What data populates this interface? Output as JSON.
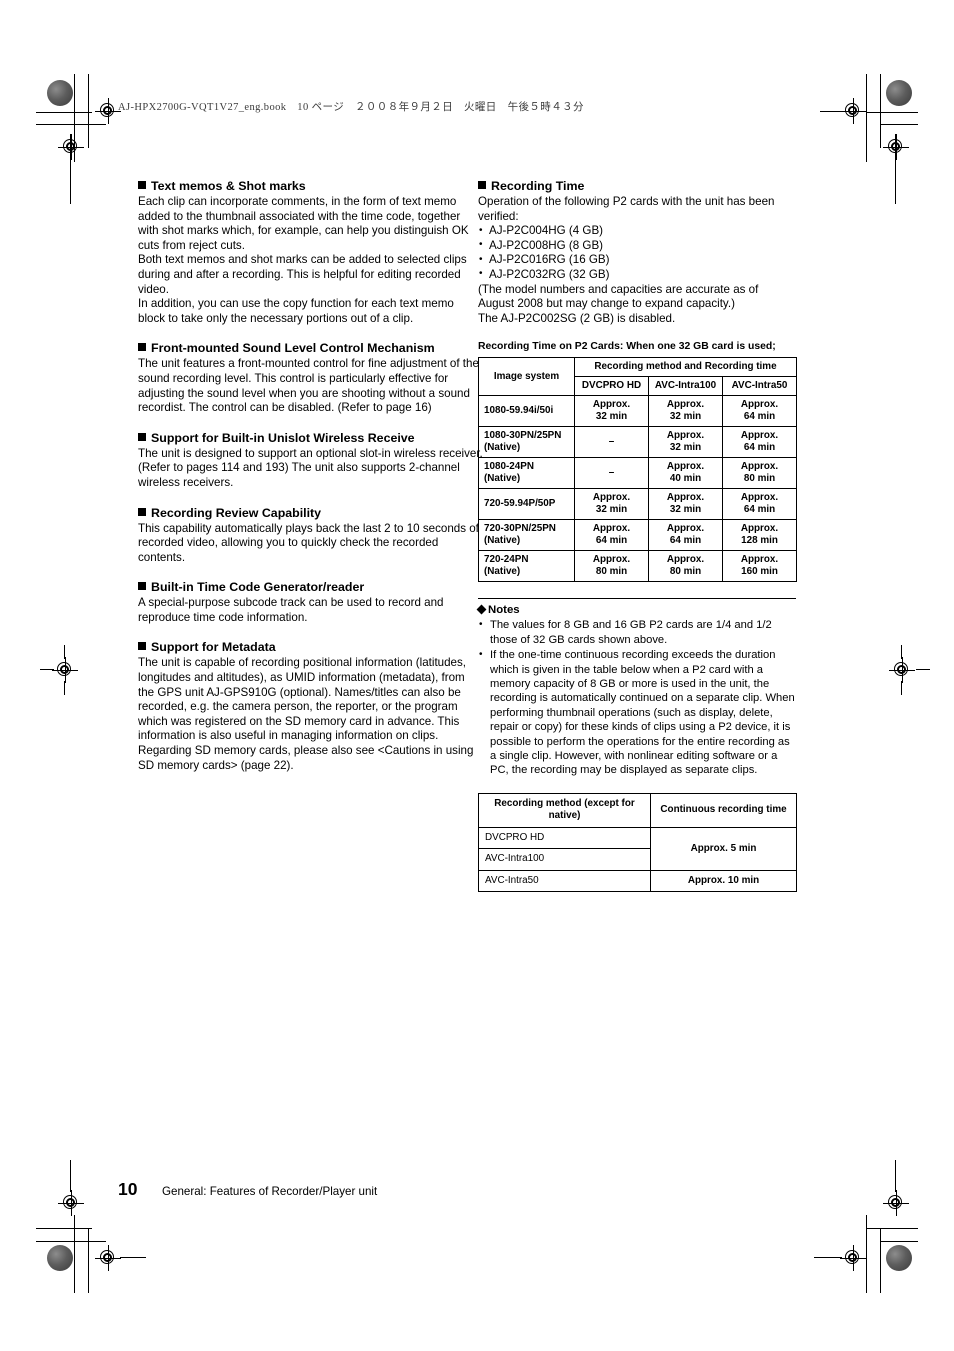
{
  "header": {
    "book_line_ascii": "AJ-HPX2700G-VQT1V27_eng.book",
    "book_line_full": "AJ-HPX2700G-VQT1V27_eng.book　10 ページ　２００８年９月２日　火曜日　午後５時４３分"
  },
  "left_column": {
    "sections": [
      {
        "title": "Text memos & Shot marks",
        "paragraphs": [
          "Each clip can incorporate comments, in the form of text memo added to the thumbnail associated with the time code, together with shot marks which, for example, can help you distinguish OK cuts from reject cuts.",
          "Both text memos and shot marks can be added to selected clips during and after a recording. This is helpful for editing recorded video.",
          "In addition, you can use the copy function for each text memo block to take only the necessary portions out of a clip."
        ]
      },
      {
        "title": "Front-mounted Sound Level Control Mechanism",
        "paragraphs": [
          "The unit features a front-mounted control for fine adjustment of the sound recording level. This control is particularly effective for adjusting the sound level when you are shooting without a sound recordist. The control can be disabled. (Refer to page 16)"
        ]
      },
      {
        "title": "Support for Built-in Unislot Wireless Receive",
        "paragraphs": [
          "The unit is designed to support an optional slot-in wireless receiver. (Refer to pages 114 and 193) The unit also supports 2-channel wireless receivers."
        ]
      },
      {
        "title": "Recording Review Capability",
        "paragraphs": [
          "This capability automatically plays back the last 2 to 10 seconds of recorded video, allowing you to quickly check the recorded contents."
        ]
      },
      {
        "title": "Built-in Time Code Generator/reader",
        "paragraphs": [
          "A special-purpose subcode track can be used to record and reproduce time code information."
        ]
      },
      {
        "title": "Support for Metadata",
        "paragraphs": [
          "The unit is capable of recording positional information (latitudes, longitudes and altitudes), as UMID information (metadata), from the GPS unit AJ-GPS910G (optional). Names/titles can also be recorded, e.g. the camera person, the reporter, or the program which was registered on the SD memory card in advance. This information is also useful in managing information on clips. Regarding SD memory cards, please also see <Cautions in using SD memory cards> (page 22)."
        ]
      }
    ]
  },
  "right_column": {
    "recording_time": {
      "title": "Recording Time",
      "intro": "Operation of the following P2 cards with the unit has been verified:",
      "cards": [
        "AJ-P2C004HG (4 GB)",
        "AJ-P2C008HG (8 GB)",
        "AJ-P2C016RG (16 GB)",
        "AJ-P2C032RG (32 GB)"
      ],
      "note_line_1": "(The model numbers and capacities are accurate as of August 2008 but may change to expand capacity.)",
      "note_line_2": "The AJ-P2C002SG (2 GB) is disabled."
    },
    "table1": {
      "caption": "Recording Time on P2 Cards: When one 32 GB card is used;",
      "header_col1": "Image system",
      "header_span": "Recording method and Recording time",
      "subheaders": [
        "DVCPRO HD",
        "AVC-Intra100",
        "AVC-Intra50"
      ],
      "rows": [
        {
          "system_line1": "1080-59.94i/50i",
          "system_line2": "",
          "values": [
            {
              "l1": "Approx.",
              "l2": "32 min"
            },
            {
              "l1": "Approx.",
              "l2": "32 min"
            },
            {
              "l1": "Approx.",
              "l2": "64 min"
            }
          ]
        },
        {
          "system_line1": "1080-30PN/25PN",
          "system_line2": "(Native)",
          "values": [
            {
              "l1": "–",
              "l2": ""
            },
            {
              "l1": "Approx.",
              "l2": "32 min"
            },
            {
              "l1": "Approx.",
              "l2": "64 min"
            }
          ]
        },
        {
          "system_line1": "1080-24PN",
          "system_line2": "(Native)",
          "values": [
            {
              "l1": "–",
              "l2": ""
            },
            {
              "l1": "Approx.",
              "l2": "40 min"
            },
            {
              "l1": "Approx.",
              "l2": "80 min"
            }
          ]
        },
        {
          "system_line1": "720-59.94P/50P",
          "system_line2": "",
          "values": [
            {
              "l1": "Approx.",
              "l2": "32 min"
            },
            {
              "l1": "Approx.",
              "l2": "32 min"
            },
            {
              "l1": "Approx.",
              "l2": "64 min"
            }
          ]
        },
        {
          "system_line1": "720-30PN/25PN",
          "system_line2": "(Native)",
          "values": [
            {
              "l1": "Approx.",
              "l2": "64 min"
            },
            {
              "l1": "Approx.",
              "l2": "64 min"
            },
            {
              "l1": "Approx.",
              "l2": "128 min"
            }
          ]
        },
        {
          "system_line1": "720-24PN",
          "system_line2": "(Native)",
          "values": [
            {
              "l1": "Approx.",
              "l2": "80 min"
            },
            {
              "l1": "Approx.",
              "l2": "80 min"
            },
            {
              "l1": "Approx.",
              "l2": "160 min"
            }
          ]
        }
      ]
    },
    "notes": {
      "title": "Notes",
      "items": [
        "The values for 8 GB and 16 GB P2 cards are 1/4 and 1/2 those of 32 GB cards shown above.",
        "If the one-time continuous recording exceeds the duration which is given in the table below when a P2 card with a memory capacity of 8 GB or more is used in the unit, the recording is automatically continued on a separate clip. When performing thumbnail operations (such as display, delete, repair or copy) for these kinds of clips using a P2 device, it is possible to perform the operations for the entire recording as a single clip. However, with nonlinear editing software or a PC, the recording may be displayed as separate clips."
      ]
    },
    "table2": {
      "header_col1": "Recording method (except for native)",
      "header_col2": "Continuous recording time",
      "rows": [
        {
          "method": "DVCPRO HD",
          "time": "Approx. 5 min",
          "time_rowspan": 2
        },
        {
          "method": "AVC-Intra100",
          "time": null,
          "time_rowspan": 0
        },
        {
          "method": "AVC-Intra50",
          "time": "Approx. 10 min",
          "time_rowspan": 1
        }
      ]
    }
  },
  "footer": {
    "page_number": "10",
    "title": "General: Features of Recorder/Player unit"
  }
}
